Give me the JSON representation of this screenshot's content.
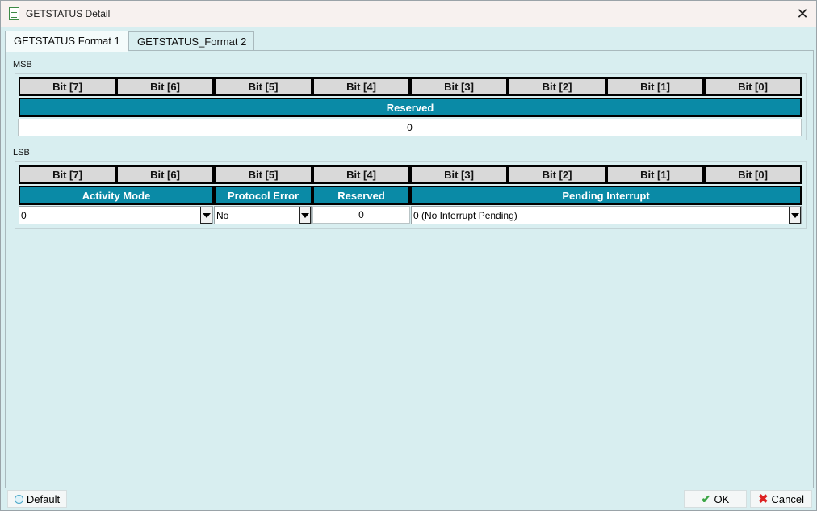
{
  "window": {
    "title": "GETSTATUS Detail",
    "close_label": "✕"
  },
  "tabs": [
    {
      "label": "GETSTATUS Format 1",
      "active": true
    },
    {
      "label": "GETSTATUS_Format 2",
      "active": false
    }
  ],
  "msb": {
    "label": "MSB",
    "bits": [
      "Bit [7]",
      "Bit [6]",
      "Bit [5]",
      "Bit [4]",
      "Bit [3]",
      "Bit [2]",
      "Bit [1]",
      "Bit [0]"
    ],
    "field": "Reserved",
    "value": "0"
  },
  "lsb": {
    "label": "LSB",
    "bits": [
      "Bit [7]",
      "Bit [6]",
      "Bit [5]",
      "Bit [4]",
      "Bit [3]",
      "Bit [2]",
      "Bit [1]",
      "Bit [0]"
    ],
    "fields": [
      "Activity Mode",
      "Protocol Error",
      "Reserved",
      "Pending Interrupt"
    ],
    "activity_mode_value": "0",
    "protocol_error_value": "No",
    "reserved_value": "0",
    "pending_interrupt_value": "0 (No Interrupt Pending)"
  },
  "footer": {
    "default_label": "Default",
    "ok_label": "OK",
    "cancel_label": "Cancel"
  },
  "colors": {
    "field_bg": "#0a8aa6",
    "header_bg": "#d9d9d9",
    "window_bg": "#d8eef0"
  }
}
